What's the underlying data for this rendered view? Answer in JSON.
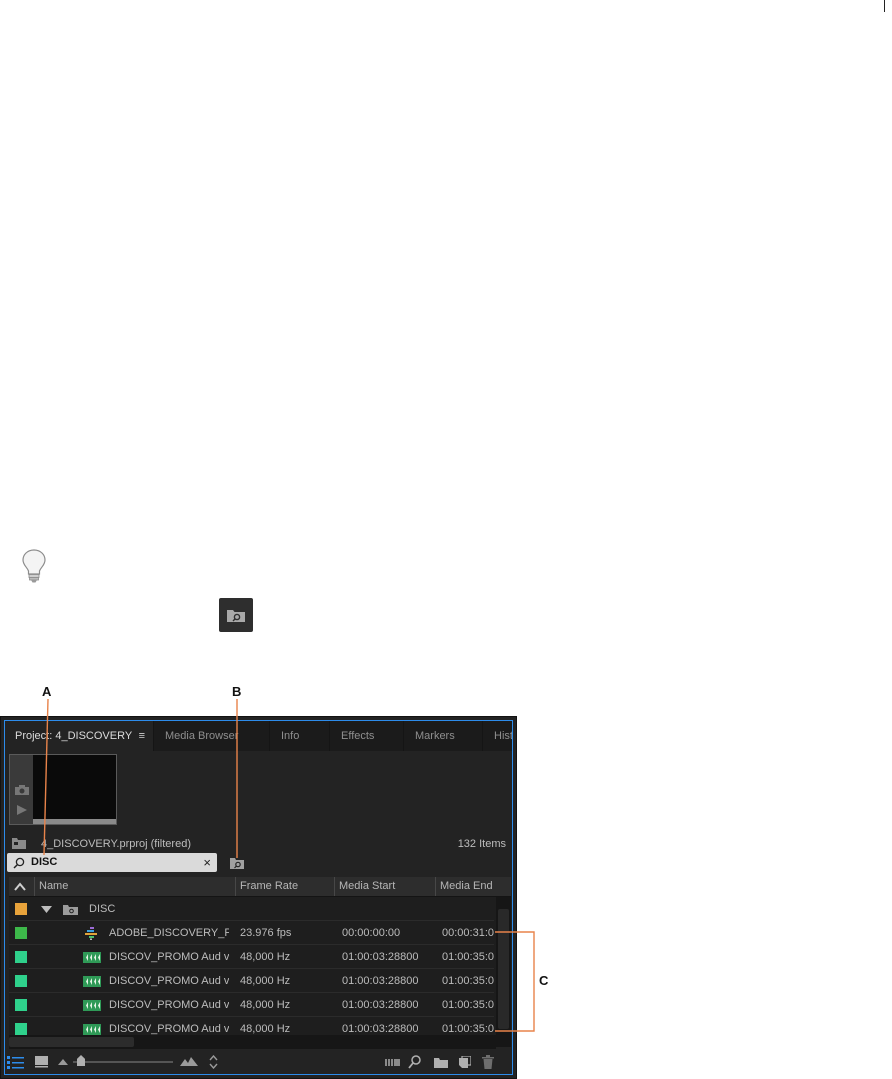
{
  "callouts": {
    "a": "A",
    "b": "B",
    "c": "C"
  },
  "panel": {
    "tabs": [
      {
        "label": "Project: 4_DISCOVERY",
        "active": true
      },
      {
        "label": "Media Browser"
      },
      {
        "label": "Info"
      },
      {
        "label": "Effects"
      },
      {
        "label": "Markers"
      },
      {
        "label": "Histo"
      }
    ],
    "tab_menu_glyph": "≡",
    "project_file": "4_DISCOVERY.prproj (filtered)",
    "items_count": "132 Items",
    "search": {
      "value": "DISC",
      "clear": "×"
    },
    "columns": {
      "name": "Name",
      "frame_rate": "Frame Rate",
      "media_start": "Media Start",
      "media_end": "Media End"
    },
    "rows": [
      {
        "label_color": "#e8a33b",
        "type": "bin",
        "name": "DISC",
        "frame_rate": "",
        "media_start": "",
        "media_end": ""
      },
      {
        "label_color": "#3db84a",
        "type": "sequence",
        "name": "ADOBE_DISCOVERY_P",
        "frame_rate": "23.976 fps",
        "media_start": "00:00:00:00",
        "media_end": "00:00:31:0"
      },
      {
        "label_color": "#2fd18c",
        "type": "audio",
        "name": "DISCOV_PROMO Aud v",
        "frame_rate": "48,000 Hz",
        "media_start": "01:00:03:28800",
        "media_end": "01:00:35:0"
      },
      {
        "label_color": "#2fd18c",
        "type": "audio",
        "name": "DISCOV_PROMO Aud v",
        "frame_rate": "48,000 Hz",
        "media_start": "01:00:03:28800",
        "media_end": "01:00:35:0"
      },
      {
        "label_color": "#2fd18c",
        "type": "audio",
        "name": "DISCOV_PROMO Aud v",
        "frame_rate": "48,000 Hz",
        "media_start": "01:00:03:28800",
        "media_end": "01:00:35:0"
      },
      {
        "label_color": "#2fd18c",
        "type": "audio",
        "name": "DISCOV_PROMO Aud v",
        "frame_rate": "48,000 Hz",
        "media_start": "01:00:03:28800",
        "media_end": "01:00:35:0"
      }
    ],
    "colors": {
      "accent": "#2d8ceb",
      "callout_line": "#e8834a",
      "panel_bg": "#232323"
    }
  }
}
